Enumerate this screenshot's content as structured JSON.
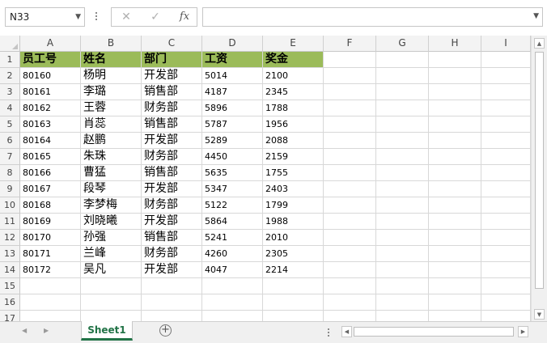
{
  "formula_bar": {
    "name_box": "N33",
    "cancel_icon": "✕",
    "enter_icon": "✓",
    "fx_label": "fx",
    "formula_value": ""
  },
  "columns": [
    "A",
    "B",
    "C",
    "D",
    "E",
    "F",
    "G",
    "H",
    "I"
  ],
  "row_numbers": [
    "1",
    "2",
    "3",
    "4",
    "5",
    "6",
    "7",
    "8",
    "9",
    "10",
    "11",
    "12",
    "13",
    "14",
    "15",
    "16",
    "17"
  ],
  "header_row": [
    "员工号",
    "姓名",
    "部门",
    "工资",
    "奖金"
  ],
  "header_fill": "#9bbb59",
  "rows": [
    [
      "80160",
      "杨明",
      "开发部",
      "5014",
      "2100"
    ],
    [
      "80161",
      "李璐",
      "销售部",
      "4187",
      "2345"
    ],
    [
      "80162",
      "王蓉",
      "财务部",
      "5896",
      "1788"
    ],
    [
      "80163",
      "肖蕊",
      "销售部",
      "5787",
      "1956"
    ],
    [
      "80164",
      "赵鹏",
      "开发部",
      "5289",
      "2088"
    ],
    [
      "80165",
      "朱珠",
      "财务部",
      "4450",
      "2159"
    ],
    [
      "80166",
      "曹猛",
      "销售部",
      "5635",
      "1755"
    ],
    [
      "80167",
      "段琴",
      "开发部",
      "5347",
      "2403"
    ],
    [
      "80168",
      "李梦梅",
      "财务部",
      "5122",
      "1799"
    ],
    [
      "80169",
      "刘晓曦",
      "开发部",
      "5864",
      "1988"
    ],
    [
      "80170",
      "孙强",
      "销售部",
      "5241",
      "2010"
    ],
    [
      "80171",
      "兰峰",
      "财务部",
      "4260",
      "2305"
    ],
    [
      "80172",
      "吴凡",
      "开发部",
      "4047",
      "2214"
    ]
  ],
  "sheet_tabs": [
    {
      "label": "Sheet1",
      "active": true
    }
  ],
  "add_sheet_icon": "+",
  "accent_color": "#217346"
}
